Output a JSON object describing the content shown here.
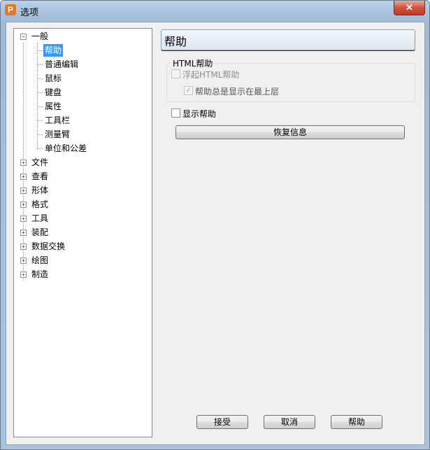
{
  "window": {
    "title": "选项",
    "app_icon_letter": "P",
    "close_glyph": "✕"
  },
  "tree": {
    "expanded_glyph": "−",
    "collapsed_glyph": "+",
    "root_general": "一般",
    "general_children": [
      "帮助",
      "普通编辑",
      "鼠标",
      "键盘",
      "属性",
      "工具栏",
      "测量臂",
      "单位和公差"
    ],
    "selected_child": "帮助",
    "roots": [
      "文件",
      "查看",
      "形体",
      "格式",
      "工具",
      "装配",
      "数据交换",
      "绘图",
      "制造"
    ]
  },
  "panel": {
    "title": "帮助",
    "group_title": "HTML帮助",
    "float_html_help": {
      "label": "浮起HTML帮助",
      "checked": false,
      "enabled": false
    },
    "help_always_on_top": {
      "label": "帮助总是显示在最上层",
      "checked": true,
      "enabled": false
    },
    "show_help": {
      "label": "显示帮助",
      "checked": false,
      "enabled": true
    },
    "restore_button": "恢复信息",
    "check_glyph": "✓"
  },
  "footer": {
    "ok": "接受",
    "cancel": "取消",
    "help": "帮助"
  },
  "colors": {
    "selection": "#3399ff",
    "close_button": "#c8452d",
    "app_icon": "#e8771f"
  }
}
